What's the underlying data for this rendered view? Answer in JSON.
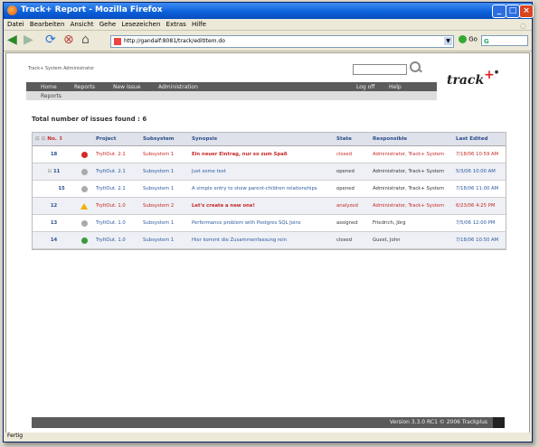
{
  "window": {
    "title": "Track+ Report - Mozilla Firefox"
  },
  "menu": [
    "Datei",
    "Bearbeiten",
    "Ansicht",
    "Gehe",
    "Lesezeichen",
    "Extras",
    "Hilfe"
  ],
  "address": {
    "url": "http://gandalf:8081/track/editItem.do",
    "go_label": "Go"
  },
  "search_engine": "G",
  "status_bar": "Fertig",
  "page": {
    "system_label": "Track+ System Administrator",
    "nav": [
      "Home",
      "Reports",
      "New Issue",
      "Administration"
    ],
    "nav_right": [
      "Log off",
      "Help"
    ],
    "sub_nav": "Reports",
    "total_label": "Total number of issues found : 6",
    "footer": "Version 3.3.0 RC1  © 2006 Trackplus",
    "logo_text": "track",
    "logo_plus": "+"
  },
  "table": {
    "sort_icons": "⊟ ⊟",
    "headers": [
      "No. ↕",
      "",
      "Project",
      "Subsystem",
      "Synopsis",
      "State",
      "Responsible",
      "Last Edited"
    ],
    "rows": [
      {
        "no": "18",
        "indent": false,
        "expand": "",
        "state_icon": "closed",
        "project": "TryItOut. 2.1",
        "subsystem": "Subsystem 1",
        "synopsis": "Ein neuer Eintrag, nur so zum Spaß",
        "state": "closed",
        "responsible": "Administrator, Track+ System",
        "edited": "7/18/06 10:59 AM",
        "highlight": true
      },
      {
        "no": "11",
        "indent": false,
        "expand": "⊟",
        "state_icon": "opened",
        "project": "TryItOut. 2.1",
        "subsystem": "Subsystem 1",
        "synopsis": "Just some test",
        "state": "opened",
        "responsible": "Administrator, Track+ System",
        "edited": "5/3/06 10:00 AM",
        "highlight": false
      },
      {
        "no": "15",
        "indent": true,
        "expand": "",
        "state_icon": "opened",
        "project": "TryItOut. 2.1",
        "subsystem": "Subsystem 1",
        "synopsis": "A simple entry to show parent-children relationships",
        "state": "opened",
        "responsible": "Administrator, Track+ System",
        "edited": "7/18/06 11:00 AM",
        "highlight": false
      },
      {
        "no": "12",
        "indent": false,
        "expand": "",
        "state_icon": "warn",
        "project": "TryItOut. 1.0",
        "subsystem": "Subsystem 2",
        "synopsis": "Let's create a new one!",
        "state": "analyzed",
        "responsible": "Administrator, Track+ System",
        "edited": "6/23/06 4:25 PM",
        "highlight": true
      },
      {
        "no": "13",
        "indent": false,
        "expand": "",
        "state_icon": "opened",
        "project": "TryItOut. 1.0",
        "subsystem": "Subsystem 1",
        "synopsis": "Performance problem with Postgres SQL Joins",
        "state": "assigned",
        "responsible": "Friedrich, Jörg",
        "edited": "7/5/06 12:00 PM",
        "highlight": false
      },
      {
        "no": "14",
        "indent": false,
        "expand": "",
        "state_icon": "done",
        "project": "TryItOut. 1.0",
        "subsystem": "Subsystem 1",
        "synopsis": "Hier kommt die Zusammenfassung rein",
        "state": "closed",
        "responsible": "Guest, John",
        "edited": "7/18/06 10:50 AM",
        "highlight": false
      }
    ]
  }
}
